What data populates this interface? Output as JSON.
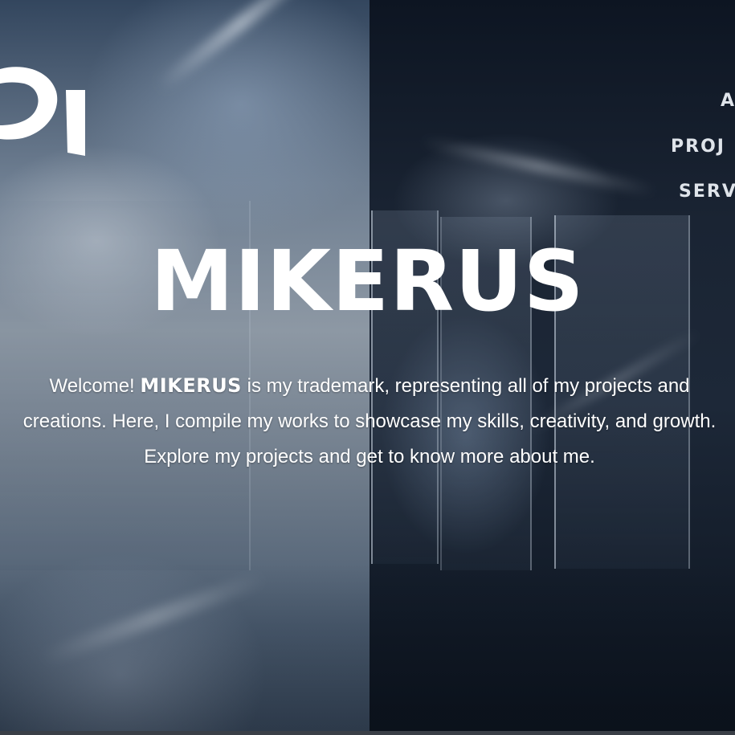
{
  "nav": {
    "items": [
      {
        "label": "A"
      },
      {
        "label": "PROJ"
      },
      {
        "label": "SERV"
      }
    ]
  },
  "hero": {
    "title": "MIKERUS",
    "intro_prefix": "Welcome!",
    "brand": "MIKERUS",
    "intro_body": "is my trademark, representing all of my projects and creations. Here, I compile my works to showcase my skills, creativity, and growth. Explore my projects and get to know more about me."
  },
  "logo": {
    "icon": "logo-mark-icon",
    "color": "#ffffff"
  },
  "colors": {
    "text": "#ffffff",
    "nav_text": "#dfe4ea",
    "dark_bg": "#0d1522"
  }
}
